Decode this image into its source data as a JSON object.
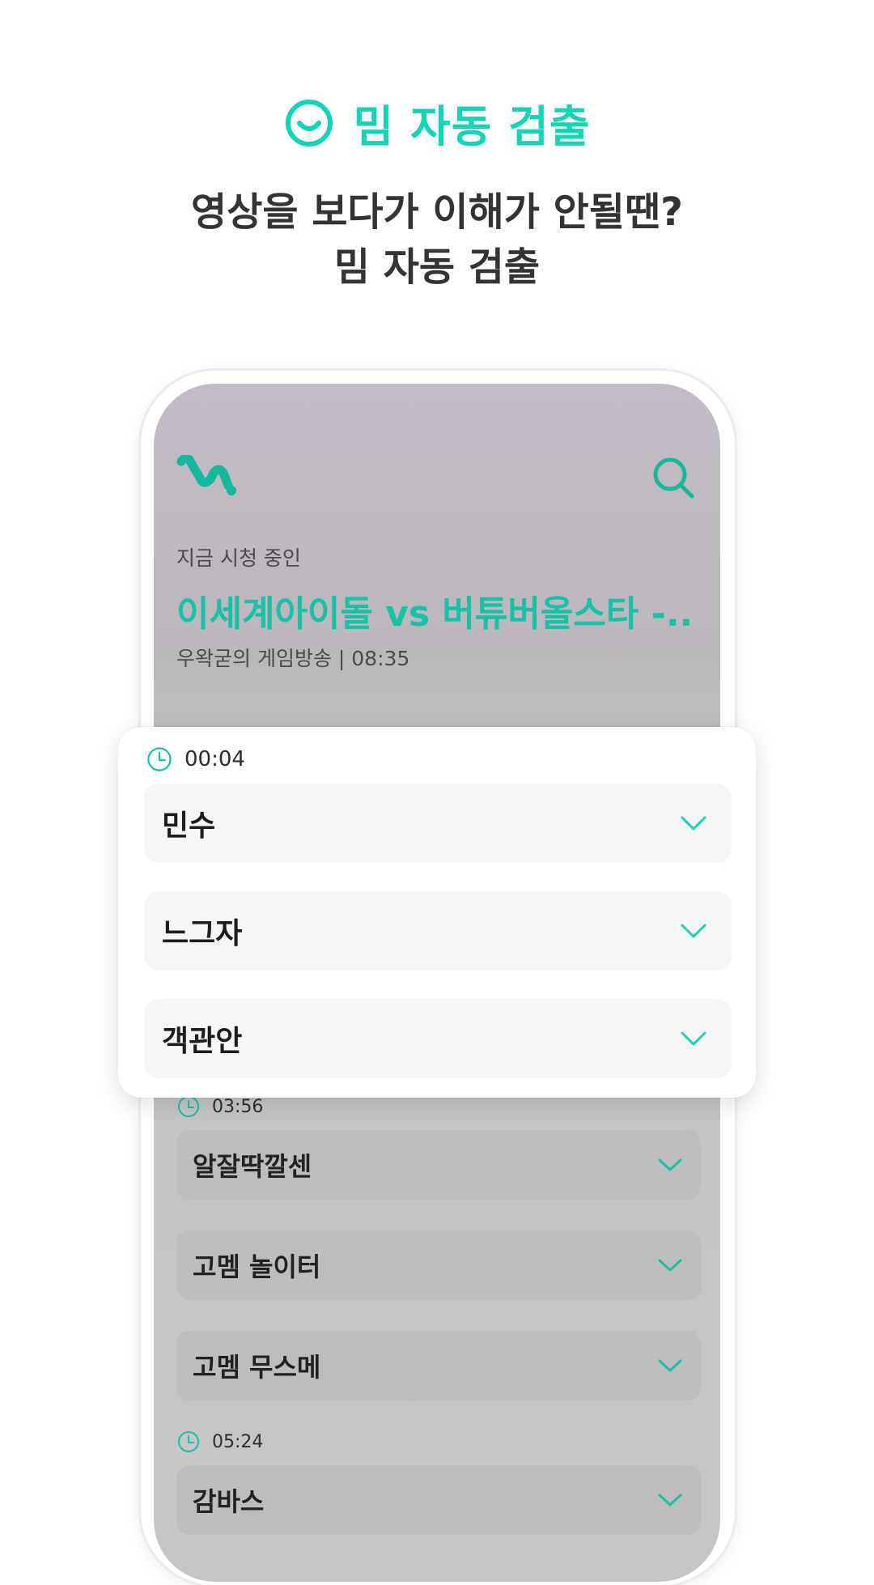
{
  "feature": {
    "icon": "smile-icon",
    "label": "밈 자동 검출"
  },
  "headline": {
    "line1": "영상을 보다가 이해가 안될땐?",
    "line2": "밈 자동 검출"
  },
  "colors": {
    "accent": "#14d4b6",
    "accent_dark": "#17c2a6"
  },
  "app": {
    "logo_icon": "app-logo-icon",
    "search_icon": "search-icon",
    "now_label": "지금 시청 중인",
    "now_title": "이세계아이돌 vs 버튜버올스타 -...",
    "now_meta": "우왁굳의 게임방송 | 08:35"
  },
  "popup": {
    "time": "00:04",
    "items": [
      {
        "label": "민수"
      },
      {
        "label": "느그자"
      },
      {
        "label": "객관안"
      }
    ]
  },
  "background_list": [
    {
      "time": "03:56",
      "items": [
        {
          "label": "알잘딱깔센"
        },
        {
          "label": "고멤 놀이터"
        },
        {
          "label": "고멤 무스메"
        }
      ]
    },
    {
      "time": "05:24",
      "items": [
        {
          "label": "감바스"
        }
      ]
    }
  ]
}
